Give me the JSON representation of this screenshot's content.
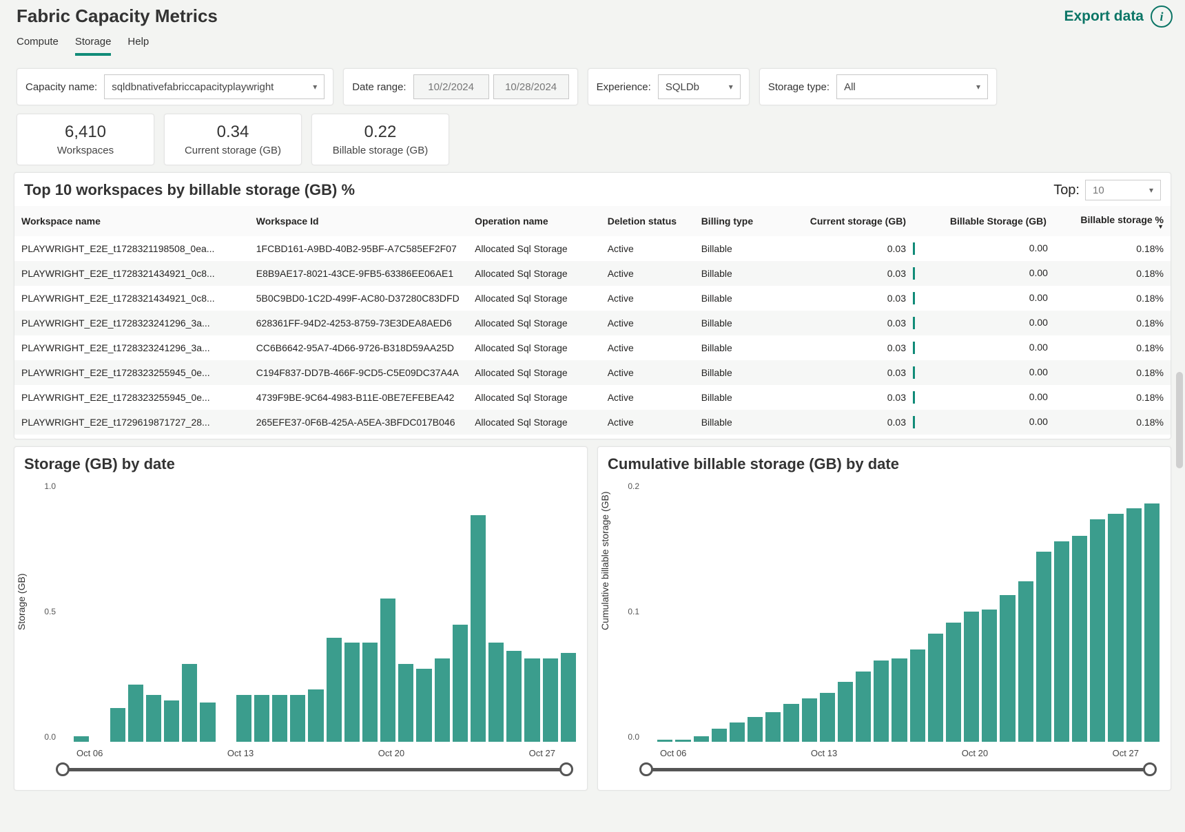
{
  "header": {
    "title": "Fabric Capacity Metrics",
    "export": "Export data"
  },
  "tabs": {
    "compute": "Compute",
    "storage": "Storage",
    "help": "Help",
    "active": "storage"
  },
  "filters": {
    "capacity_label": "Capacity name:",
    "capacity_value": "sqldbnativefabriccapacityplaywright",
    "date_label": "Date range:",
    "date_start": "10/2/2024",
    "date_end": "10/28/2024",
    "experience_label": "Experience:",
    "experience_value": "SQLDb",
    "storage_label": "Storage type:",
    "storage_value": "All"
  },
  "kpis": [
    {
      "value": "6,410",
      "label": "Workspaces"
    },
    {
      "value": "0.34",
      "label": "Current storage (GB)"
    },
    {
      "value": "0.22",
      "label": "Billable storage (GB)"
    }
  ],
  "table": {
    "title": "Top 10 workspaces by billable storage (GB) %",
    "top_label": "Top:",
    "top_value": "10",
    "cols": [
      "Workspace name",
      "Workspace Id",
      "Operation name",
      "Deletion status",
      "Billing type",
      "Current storage (GB)",
      "Billable Storage (GB)",
      "Billable storage %"
    ],
    "rows": [
      {
        "name": "PLAYWRIGHT_E2E_t1728321198508_0ea...",
        "id": "1FCBD161-A9BD-40B2-95BF-A7C585EF2F07",
        "op": "Allocated Sql Storage",
        "del": "Active",
        "bill": "Billable",
        "curr": "0.03",
        "billgb": "0.00",
        "pct": "0.18%"
      },
      {
        "name": "PLAYWRIGHT_E2E_t1728321434921_0c8...",
        "id": "E8B9AE17-8021-43CE-9FB5-63386EE06AE1",
        "op": "Allocated Sql Storage",
        "del": "Active",
        "bill": "Billable",
        "curr": "0.03",
        "billgb": "0.00",
        "pct": "0.18%"
      },
      {
        "name": "PLAYWRIGHT_E2E_t1728321434921_0c8...",
        "id": "5B0C9BD0-1C2D-499F-AC80-D37280C83DFD",
        "op": "Allocated Sql Storage",
        "del": "Active",
        "bill": "Billable",
        "curr": "0.03",
        "billgb": "0.00",
        "pct": "0.18%"
      },
      {
        "name": "PLAYWRIGHT_E2E_t1728323241296_3a...",
        "id": "628361FF-94D2-4253-8759-73E3DEA8AED6",
        "op": "Allocated Sql Storage",
        "del": "Active",
        "bill": "Billable",
        "curr": "0.03",
        "billgb": "0.00",
        "pct": "0.18%"
      },
      {
        "name": "PLAYWRIGHT_E2E_t1728323241296_3a...",
        "id": "CC6B6642-95A7-4D66-9726-B318D59AA25D",
        "op": "Allocated Sql Storage",
        "del": "Active",
        "bill": "Billable",
        "curr": "0.03",
        "billgb": "0.00",
        "pct": "0.18%"
      },
      {
        "name": "PLAYWRIGHT_E2E_t1728323255945_0e...",
        "id": "C194F837-DD7B-466F-9CD5-C5E09DC37A4A",
        "op": "Allocated Sql Storage",
        "del": "Active",
        "bill": "Billable",
        "curr": "0.03",
        "billgb": "0.00",
        "pct": "0.18%"
      },
      {
        "name": "PLAYWRIGHT_E2E_t1728323255945_0e...",
        "id": "4739F9BE-9C64-4983-B11E-0BE7EFEBEA42",
        "op": "Allocated Sql Storage",
        "del": "Active",
        "bill": "Billable",
        "curr": "0.03",
        "billgb": "0.00",
        "pct": "0.18%"
      },
      {
        "name": "PLAYWRIGHT_E2E_t1729619871727_28...",
        "id": "265EFE37-0F6B-425A-A5EA-3BFDC017B046",
        "op": "Allocated Sql Storage",
        "del": "Active",
        "bill": "Billable",
        "curr": "0.03",
        "billgb": "0.00",
        "pct": "0.18%"
      }
    ]
  },
  "chart_data": [
    {
      "type": "bar",
      "title": "Storage (GB) by date",
      "ylabel": "Storage (GB)",
      "ylim": [
        0,
        1.0
      ],
      "yticks": [
        "1.0",
        "0.5",
        "0.0"
      ],
      "xticks": [
        "Oct 06",
        "Oct 13",
        "Oct 20",
        "Oct 27"
      ],
      "categories": [
        "Oct 02",
        "Oct 03",
        "Oct 04",
        "Oct 05",
        "Oct 06",
        "Oct 07",
        "Oct 08",
        "Oct 09",
        "Oct 10",
        "Oct 11",
        "Oct 12",
        "Oct 13",
        "Oct 14",
        "Oct 15",
        "Oct 16",
        "Oct 17",
        "Oct 18",
        "Oct 19",
        "Oct 20",
        "Oct 21",
        "Oct 22",
        "Oct 23",
        "Oct 24",
        "Oct 25",
        "Oct 26",
        "Oct 27",
        "Oct 28"
      ],
      "values": [
        0,
        0.02,
        0,
        0.13,
        0.22,
        0.18,
        0.16,
        0.3,
        0.15,
        0,
        0.18,
        0.18,
        0.18,
        0.18,
        0.2,
        0.4,
        0.38,
        0.38,
        0.55,
        0.3,
        0.28,
        0.32,
        0.45,
        0.87,
        0.38,
        0.35,
        0.32,
        0.32,
        0.34
      ]
    },
    {
      "type": "bar",
      "title": "Cumulative billable storage (GB) by date",
      "ylabel": "Cumulative billable storage (GB)",
      "ylim": [
        0,
        0.24
      ],
      "yticks": [
        "0.2",
        "0.1",
        "0.0"
      ],
      "xticks": [
        "Oct 06",
        "Oct 13",
        "Oct 20",
        "Oct 27"
      ],
      "categories": [
        "Oct 02",
        "Oct 03",
        "Oct 04",
        "Oct 05",
        "Oct 06",
        "Oct 07",
        "Oct 08",
        "Oct 09",
        "Oct 10",
        "Oct 11",
        "Oct 12",
        "Oct 13",
        "Oct 14",
        "Oct 15",
        "Oct 16",
        "Oct 17",
        "Oct 18",
        "Oct 19",
        "Oct 20",
        "Oct 21",
        "Oct 22",
        "Oct 23",
        "Oct 24",
        "Oct 25",
        "Oct 26",
        "Oct 27",
        "Oct 28"
      ],
      "values": [
        0,
        0.002,
        0.002,
        0.005,
        0.012,
        0.018,
        0.023,
        0.027,
        0.035,
        0.04,
        0.045,
        0.055,
        0.065,
        0.075,
        0.077,
        0.085,
        0.1,
        0.11,
        0.12,
        0.122,
        0.135,
        0.148,
        0.175,
        0.185,
        0.19,
        0.205,
        0.21,
        0.215,
        0.22
      ]
    }
  ]
}
